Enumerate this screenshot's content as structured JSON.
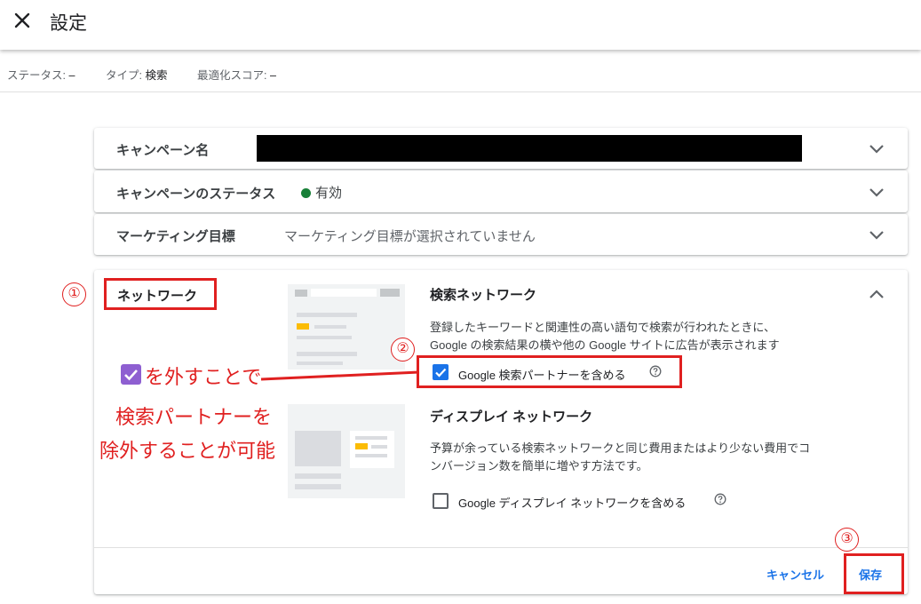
{
  "header": {
    "title": "設定"
  },
  "status": [
    {
      "label": "ステータス: ",
      "value": "–"
    },
    {
      "label": "タイプ: ",
      "value": "検索"
    },
    {
      "label": "最適化スコア: ",
      "value": "–"
    }
  ],
  "campaign_name": {
    "label": "キャンペーン名"
  },
  "campaign_status": {
    "label": "キャンペーンのステータス",
    "value": "有効",
    "dot_color": "#188038"
  },
  "marketing_goal": {
    "label": "マーケティング目標",
    "value": "マーケティング目標が選択されていません"
  },
  "network": {
    "label": "ネットワーク",
    "search": {
      "title": "検索ネットワーク",
      "desc_line1": "登録したキーワードと関連性の高い語句で検索が行われたときに、",
      "desc_line2": "Google の検索結果の横や他の Google サイトに広告が表示されます",
      "checkbox_label": "Google 検索パートナーを含める",
      "checked": true
    },
    "display": {
      "title": "ディスプレイ ネットワーク",
      "desc_line1": "予算が余っている検索ネットワークと同じ費用またはより少ない費用でコ",
      "desc_line2": "ンバージョン数を簡単に増やす方法です。",
      "checkbox_label": "Google ディスプレイ ネットワークを含める",
      "checked": false
    },
    "cancel_label": "キャンセル",
    "save_label": "保存"
  },
  "annotations": {
    "num1": "①",
    "num2": "②",
    "num3": "③",
    "line1": "を外すことで",
    "line2": "検索パートナーを",
    "line3": "除外することが可能"
  },
  "colors": {
    "accent": "#1a73e8",
    "annotation_red": "#e02020",
    "status_green": "#188038",
    "highlight_yellow": "#fbbc04"
  }
}
